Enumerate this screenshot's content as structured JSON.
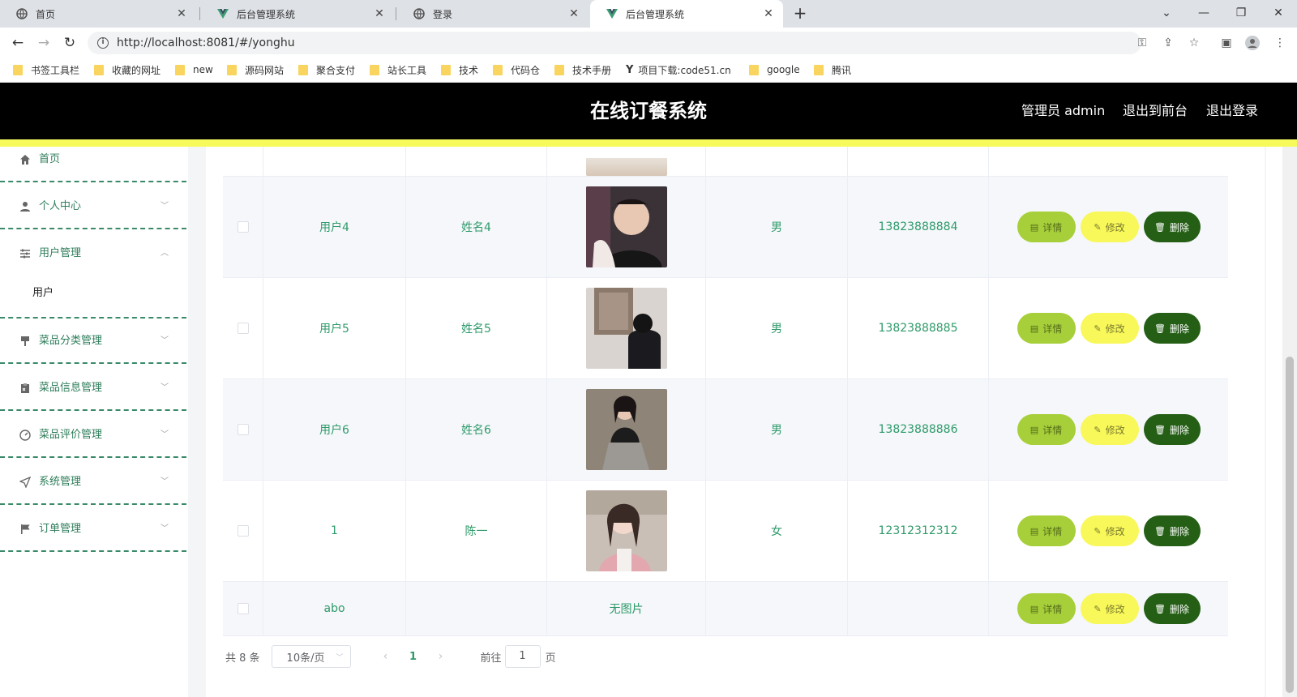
{
  "browser": {
    "tabs": [
      {
        "title": "首页",
        "icon": "globe-icon",
        "active": false
      },
      {
        "title": "后台管理系统",
        "icon": "vue-logo-icon",
        "active": false
      },
      {
        "title": "登录",
        "icon": "globe-icon",
        "active": false
      },
      {
        "title": "后台管理系统",
        "icon": "vue-logo-icon",
        "active": true
      }
    ],
    "url": "http://localhost:8081/#/yonghu",
    "bookmarks": [
      "书签工具栏",
      "收藏的网址",
      "new",
      "源码网站",
      "聚合支付",
      "站长工具",
      "技术",
      "代码仓",
      "技术手册",
      "项目下载:code51.cn",
      "google",
      "腾讯"
    ]
  },
  "header": {
    "title": "在线订餐系统",
    "admin_label": "管理员 admin",
    "back_to_front": "退出到前台",
    "logout": "退出登录",
    "accent_color": "#f7fa5b"
  },
  "sidebar": {
    "items": [
      {
        "label": "首页",
        "icon": "home-icon"
      },
      {
        "label": "个人中心",
        "icon": "user-icon"
      },
      {
        "label": "用户管理",
        "icon": "sliders-icon",
        "expanded": true,
        "children": [
          "用户"
        ]
      },
      {
        "label": "菜品分类管理",
        "icon": "brush-icon"
      },
      {
        "label": "菜品信息管理",
        "icon": "clipboard-icon"
      },
      {
        "label": "菜品评价管理",
        "icon": "gauge-icon"
      },
      {
        "label": "系统管理",
        "icon": "send-icon"
      },
      {
        "label": "订单管理",
        "icon": "flag-icon"
      }
    ]
  },
  "table": {
    "rows": [
      {
        "username": "用户4",
        "name": "姓名4",
        "photo": "photo",
        "gender": "男",
        "phone": "13823888884"
      },
      {
        "username": "用户5",
        "name": "姓名5",
        "photo": "photo",
        "gender": "男",
        "phone": "13823888885"
      },
      {
        "username": "用户6",
        "name": "姓名6",
        "photo": "photo",
        "gender": "男",
        "phone": "13823888886"
      },
      {
        "username": "1",
        "name": "陈一",
        "photo": "photo",
        "gender": "女",
        "phone": "12312312312"
      },
      {
        "username": "abo",
        "name": "",
        "photo": "无图片",
        "gender": "",
        "phone": ""
      }
    ],
    "actions": {
      "detail": "详情",
      "edit": "修改",
      "delete": "删除"
    },
    "colors": {
      "detail": "#a6cf3a",
      "edit": "#f8f85a",
      "delete": "#245f15",
      "text": "#2e9a6a"
    }
  },
  "pagination": {
    "total": "共 8 条",
    "page_size": "10条/页",
    "current_page": "1",
    "goto_prefix": "前往",
    "goto_value": "1",
    "goto_suffix": "页"
  }
}
